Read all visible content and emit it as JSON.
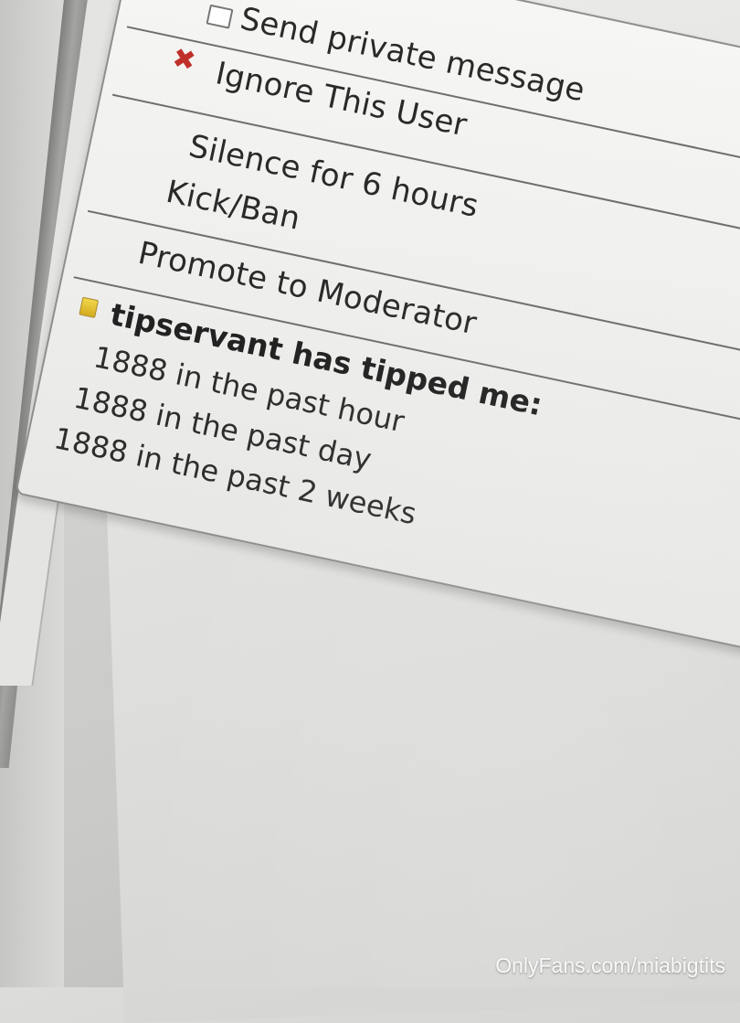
{
  "menu": {
    "items": [
      {
        "label": "Send private message",
        "icon": "message-icon"
      },
      {
        "label": "Ignore This User",
        "icon": "x-icon"
      },
      {
        "label": "Silence for 6 hours"
      },
      {
        "label": "Kick/Ban"
      },
      {
        "label": "Promote to Moderator"
      }
    ],
    "tip_info": {
      "icon": "crown-icon",
      "title": "tipservant has tipped me:",
      "lines": [
        "1888 in the past hour",
        "1888 in the past day",
        "1888 in the past 2 weeks"
      ]
    }
  },
  "watermark": "OnlyFans.com/miabigtits",
  "colors": {
    "ignore_icon": "#c0302b",
    "crown_icon": "#e0bc30",
    "menu_bg": "#f0f0ee",
    "text": "#2a2a2a"
  }
}
